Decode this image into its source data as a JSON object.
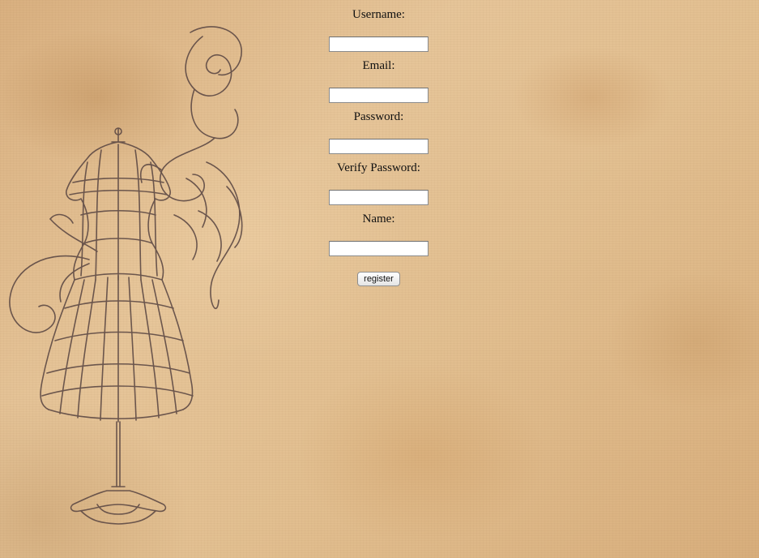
{
  "form": {
    "fields": [
      {
        "label": "Username:",
        "value": ""
      },
      {
        "label": "Email:",
        "value": ""
      },
      {
        "label": "Password:",
        "value": ""
      },
      {
        "label": "Verify Password:",
        "value": ""
      },
      {
        "label": "Name:",
        "value": ""
      }
    ],
    "submit_label": "register"
  },
  "decoration": {
    "illustration": "dress-form-mannequin",
    "ink_color": "#5e4a45",
    "paper_color": "#e2bf90"
  }
}
